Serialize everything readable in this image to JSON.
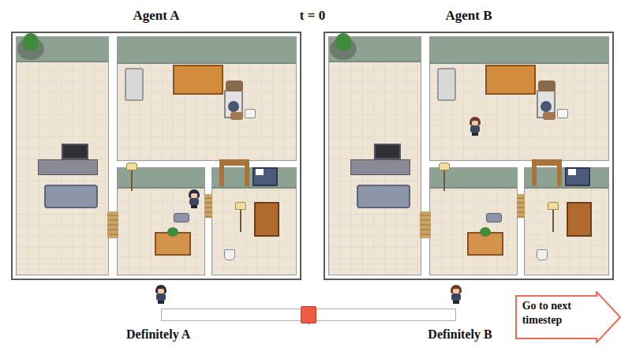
{
  "time": "t = 0",
  "maps": [
    {
      "title": "Agent A",
      "agent": {
        "room": "middle",
        "color": "#2a2c3c"
      }
    },
    {
      "title": "Agent B",
      "agent": {
        "room": "top",
        "color": "#6e3b28"
      }
    }
  ],
  "slider": {
    "left_label": "Definitely A",
    "right_label": "Definitely B",
    "level": 0.5
  },
  "next_button": {
    "label": "Go to next timestep"
  }
}
